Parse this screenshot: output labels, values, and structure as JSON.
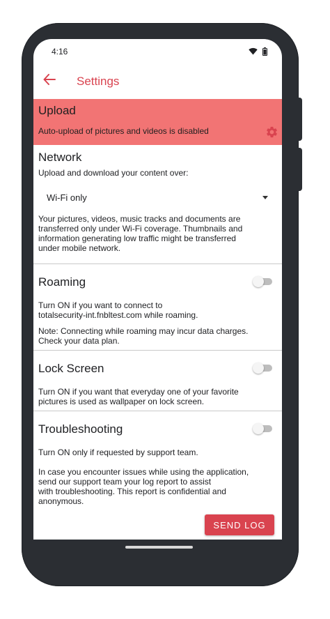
{
  "status": {
    "time": "4:16"
  },
  "appbar": {
    "title": "Settings"
  },
  "upload": {
    "title": "Upload",
    "description": "Auto-upload of pictures and videos is disabled"
  },
  "network": {
    "title": "Network",
    "subtitle": "Upload and download your content over:",
    "selected": "Wi-Fi only",
    "description_lines": [
      "Your pictures, videos, music tracks and documents are",
      "transferred only under Wi-Fi coverage. Thumbnails and",
      "information generating low traffic might be transferred",
      "under mobile network."
    ]
  },
  "roaming": {
    "title": "Roaming",
    "on": false,
    "desc_lines": [
      "Turn ON if you want to connect to",
      "totalsecurity-int.fnbltest.com while roaming."
    ],
    "note_lines": [
      "Note: Connecting while roaming may incur data charges.",
      "Check your data plan."
    ]
  },
  "lockscreen": {
    "title": "Lock Screen",
    "on": false,
    "desc_lines": [
      "Turn ON if you want that everyday one of your favorite",
      "pictures is used as wallpaper on lock screen."
    ]
  },
  "troubleshooting": {
    "title": "Troubleshooting",
    "on": false,
    "desc": "Turn ON only if requested by support team.",
    "info_lines": [
      "In case you encounter issues while using the application,",
      "send our support team your log report to assist",
      "with troubleshooting. This report is confidential and",
      "anonymous."
    ],
    "button_label": "SEND LOG"
  },
  "colors": {
    "accent": "#d9434f",
    "upload_bg": "#f27474",
    "phone_frame": "#2b2e33"
  }
}
